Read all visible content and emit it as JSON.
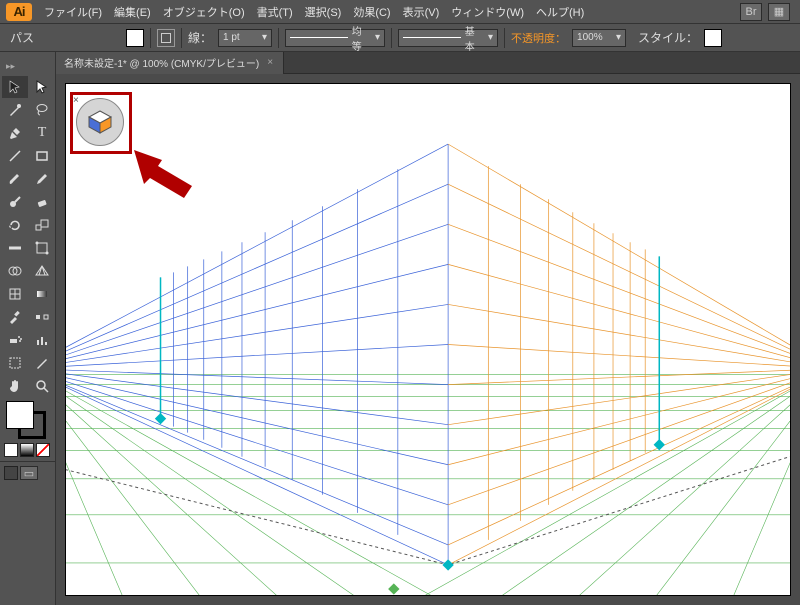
{
  "app": {
    "icon_text": "Ai"
  },
  "menu": {
    "items": [
      "ファイル(F)",
      "編集(E)",
      "オブジェクト(O)",
      "書式(T)",
      "選択(S)",
      "効果(C)",
      "表示(V)",
      "ウィンドウ(W)",
      "ヘルプ(H)"
    ],
    "right_btn1": "Br",
    "right_btn2": "▦"
  },
  "control": {
    "mode": "パス",
    "stroke_label": "線：",
    "stroke_weight": "1 pt",
    "profile_label": "均等",
    "brush_label": "基本",
    "opacity_label": "不透明度：",
    "opacity_value": "100%",
    "style_label": "スタイル："
  },
  "doc": {
    "tab_title": "名称未設定-1* @ 100% (CMYK/プレビュー)",
    "tab_close": "×"
  },
  "toolbar": {
    "sub": "▸▸",
    "tools": [
      "selection",
      "direct-selection",
      "magic-wand",
      "lasso",
      "pen",
      "type",
      "line",
      "rectangle",
      "paintbrush",
      "pencil",
      "blob-brush",
      "eraser",
      "rotate",
      "scale",
      "width",
      "free-transform",
      "shape-builder",
      "perspective-grid",
      "mesh",
      "gradient",
      "eyedropper",
      "blend",
      "symbol-sprayer",
      "column-graph",
      "artboard",
      "slice",
      "hand",
      "zoom"
    ]
  },
  "colors": {
    "fill": "#ffffff",
    "stroke": "#000000"
  },
  "widget": {
    "close": "×"
  }
}
